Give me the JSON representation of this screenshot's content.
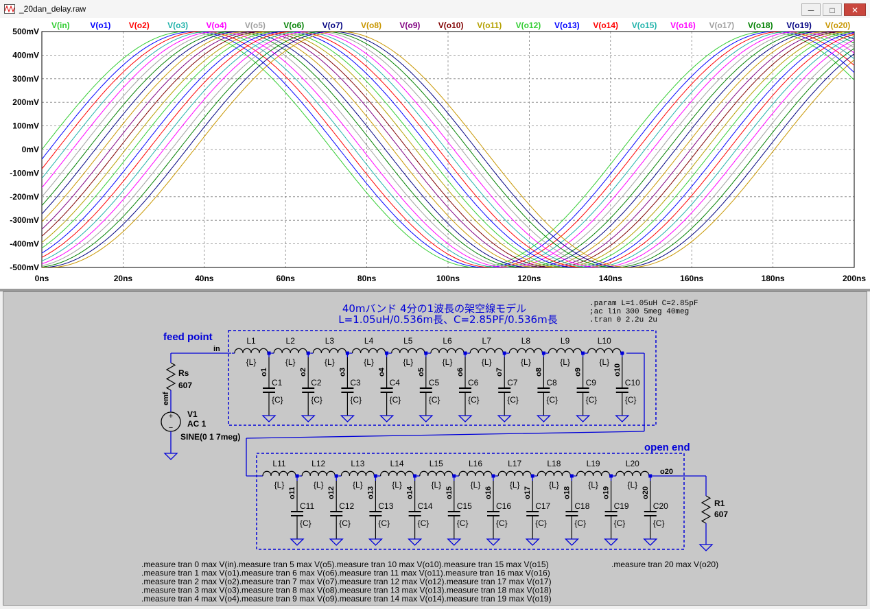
{
  "window": {
    "title": "_20dan_delay.raw",
    "minimize_glyph": "─",
    "maximize_glyph": "□",
    "close_glyph": "✕"
  },
  "chart_data": {
    "type": "line",
    "x_axis": {
      "min": 0,
      "max": 200,
      "unit": "ns",
      "tick_labels": [
        "0ns",
        "20ns",
        "40ns",
        "60ns",
        "80ns",
        "100ns",
        "120ns",
        "140ns",
        "160ns",
        "180ns",
        "200ns"
      ]
    },
    "y_axis": {
      "min": -500,
      "max": 500,
      "unit": "mV",
      "tick_labels": [
        "500mV",
        "400mV",
        "300mV",
        "200mV",
        "100mV",
        "0mV",
        "-100mV",
        "-200mV",
        "-300mV",
        "-400mV",
        "-500mV"
      ]
    },
    "grid": true,
    "legend_placement": "top",
    "waveform": {
      "amplitude_mV": 500,
      "frequency_MHz": 7,
      "delay_per_stage_ns": 1.875
    },
    "series": [
      {
        "name": "V(in)",
        "color": "#32cd32"
      },
      {
        "name": "V(o1)",
        "color": "#0000ff"
      },
      {
        "name": "V(o2)",
        "color": "#ff0000"
      },
      {
        "name": "V(o3)",
        "color": "#20b2aa"
      },
      {
        "name": "V(o4)",
        "color": "#ff00ff"
      },
      {
        "name": "V(o5)",
        "color": "#a0a0a0"
      },
      {
        "name": "V(o6)",
        "color": "#008000"
      },
      {
        "name": "V(o7)",
        "color": "#000080"
      },
      {
        "name": "V(o8)",
        "color": "#c89600"
      },
      {
        "name": "V(o9)",
        "color": "#800080"
      },
      {
        "name": "V(o10)",
        "color": "#800000"
      },
      {
        "name": "V(o11)",
        "color": "#b4a000"
      },
      {
        "name": "V(o12)",
        "color": "#32cd32"
      },
      {
        "name": "V(o13)",
        "color": "#0000ff"
      },
      {
        "name": "V(o14)",
        "color": "#ff0000"
      },
      {
        "name": "V(o15)",
        "color": "#20b2aa"
      },
      {
        "name": "V(o16)",
        "color": "#ff00ff"
      },
      {
        "name": "V(o17)",
        "color": "#a0a0a0"
      },
      {
        "name": "V(o18)",
        "color": "#008000"
      },
      {
        "name": "V(o19)",
        "color": "#000080"
      },
      {
        "name": "V(o20)",
        "color": "#c89600"
      }
    ]
  },
  "schematic": {
    "title_line1": "40mバンド 4分の1波長の架空線モデル",
    "title_line2": "L=1.05uH/0.536m長、C=2.85PF/0.536m長",
    "directives": [
      ".param L=1.05uH C=2.85pF",
      ";ac lin 300 5meg 40meg",
      ".tran 0 2.2u 2u"
    ],
    "feed_point_label": "feed point",
    "open_end_label": "open end",
    "in_label": "in",
    "emf_label": "emf",
    "out_label": "o20",
    "rs": {
      "name": "Rs",
      "value": "607"
    },
    "r1": {
      "name": "R1",
      "value": "607"
    },
    "source": {
      "name": "V1",
      "ac": "AC 1",
      "sine": "SINE(0 1 7meg)",
      "plus": "+",
      "minus": "−"
    },
    "inductor_value": "{L}",
    "capacitor_value": "{C}",
    "row1": {
      "inductors": [
        "L1",
        "L2",
        "L3",
        "L4",
        "L5",
        "L6",
        "L7",
        "L8",
        "L9",
        "L10"
      ],
      "capacitors": [
        "C1",
        "C2",
        "C3",
        "C4",
        "C5",
        "C6",
        "C7",
        "C8",
        "C9",
        "C10"
      ],
      "nodes": [
        "o1",
        "o2",
        "o3",
        "o4",
        "o5",
        "o6",
        "o7",
        "o8",
        "o9",
        "o10"
      ]
    },
    "row2": {
      "inductors": [
        "L11",
        "L12",
        "L13",
        "L14",
        "L15",
        "L16",
        "L17",
        "L18",
        "L19",
        "L20"
      ],
      "capacitors": [
        "C11",
        "C12",
        "C13",
        "C14",
        "C15",
        "C16",
        "C17",
        "C18",
        "C19",
        "C20"
      ],
      "nodes": [
        "o11",
        "o12",
        "o13",
        "o14",
        "o15",
        "o16",
        "o17",
        "o18",
        "o19",
        "o20"
      ]
    },
    "measure_lines": [
      ".measure tran 0 max V(in).measure tran 5 max V(o5).measure tran 10 max V(o10).measure tran 15 max V(o15)",
      ".measure tran 1 max V(o1).measure tran 6 max V(o6).measure tran 11 max V(o11).measure tran 16 max V(o16)",
      ".measure tran 2 max V(o2).measure tran 7 max V(o7).measure tran 12 max V(o12).measure tran 17 max V(o17)",
      ".measure tran 3 max V(o3).measure tran 8 max V(o8).measure tran 13 max V(o13).measure tran 18 max V(o18)",
      ".measure tran 4 max V(o4).measure tran 9 max V(o9).measure tran 14 max V(o14).measure tran 19 max V(o19)"
    ],
    "measure_extra": ".measure tran 20 max V(o20)"
  }
}
